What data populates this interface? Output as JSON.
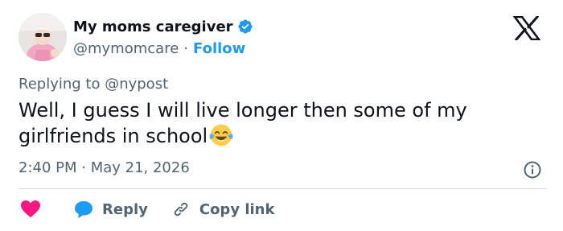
{
  "author": {
    "display_name": "My moms caregiver",
    "handle": "@mymomcare",
    "separator": "·",
    "follow_label": "Follow",
    "verified": true
  },
  "reply_context": {
    "text": "Replying to @nypost"
  },
  "tweet": {
    "text": "Well, I guess I will live longer then some of my girlfriends in school",
    "emoji": "face-with-tears-of-joy",
    "timestamp": "2:40 PM · May 21, 2026"
  },
  "actions": {
    "reply_label": "Reply",
    "copy_link_label": "Copy link"
  },
  "colors": {
    "text": "#0f1419",
    "secondary": "#536471",
    "accent": "#1d9bf0",
    "like": "#f91880",
    "divider": "#cfd9de"
  },
  "icons": [
    "x-logo",
    "verified-badge-icon",
    "info-icon",
    "heart-icon",
    "reply-bubble-icon",
    "link-icon",
    "face-with-tears-of-joy-emoji"
  ]
}
